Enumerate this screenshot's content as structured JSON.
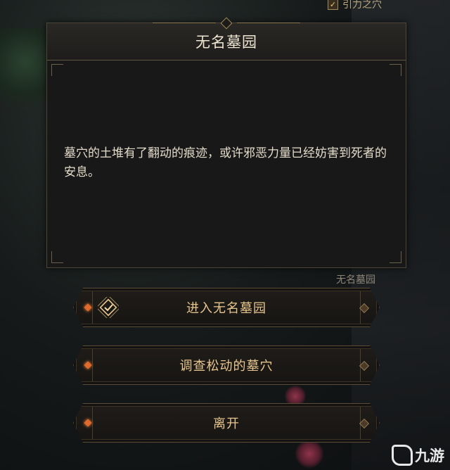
{
  "top_quest": {
    "label": "引力之穴"
  },
  "dialog": {
    "title": "无名墓园",
    "body": "墓穴的土堆有了翻动的痕迹，或许邪恶力量已经妨害到死者的安息。"
  },
  "location_label": "无名墓园",
  "options": [
    {
      "label": "进入无名墓园",
      "icon": "check-diamond-icon"
    },
    {
      "label": "调查松动的墓穴"
    },
    {
      "label": "离开"
    }
  ],
  "watermark": {
    "text": "九游"
  },
  "colors": {
    "accent_gold": "#e7c68e",
    "gem_orange": "#e06a2e",
    "panel_bg": "#171817"
  }
}
